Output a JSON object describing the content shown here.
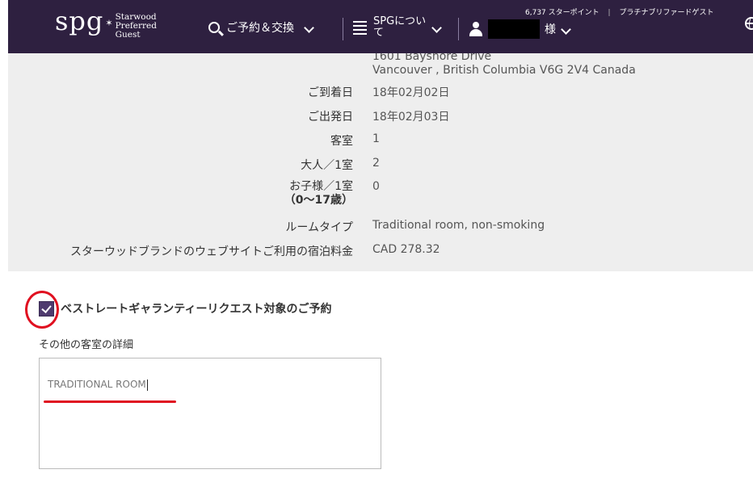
{
  "header": {
    "logo": {
      "mark": "spg",
      "lines": [
        "Starwood",
        "Preferred",
        "Guest"
      ]
    },
    "points": "6,737 スターポイント",
    "member_level": "プラチナブリファードゲスト",
    "nav": {
      "search_label": "ご予約＆交換",
      "about_label": "SPGについて",
      "user_suffix": "様"
    }
  },
  "summary": {
    "address_line1": "1601 Bayshore Drive",
    "address_line2": "Vancouver , British Columbia V6G 2V4 Canada",
    "rows": [
      {
        "label": "ご到着日",
        "value": "18年02月02日"
      },
      {
        "label": "ご出発日",
        "value": "18年02月03日"
      },
      {
        "label": "客室",
        "value": "1"
      },
      {
        "label": "大人／1室",
        "value": "2"
      },
      {
        "label": "お子様／1室",
        "sublabel": "（0〜17歳）",
        "value": "0"
      },
      {
        "label": "ルームタイプ",
        "value": "Traditional room, non-smoking"
      },
      {
        "label": "スターウッドブランドのウェブサイトご利用の宿泊料金",
        "value": "CAD 278.32"
      }
    ]
  },
  "form": {
    "checkbox_label": "ベストレートギャランティーリクエスト対象のご予約",
    "checkbox_checked": true,
    "details_label": "その他の客室の詳細",
    "details_value": "TRADITIONAL ROOM"
  },
  "colors": {
    "header_bg": "#2e2040",
    "checkbox": "#4e3a6e",
    "annotation_red": "#e01020",
    "summary_bg": "#eeeeee"
  }
}
